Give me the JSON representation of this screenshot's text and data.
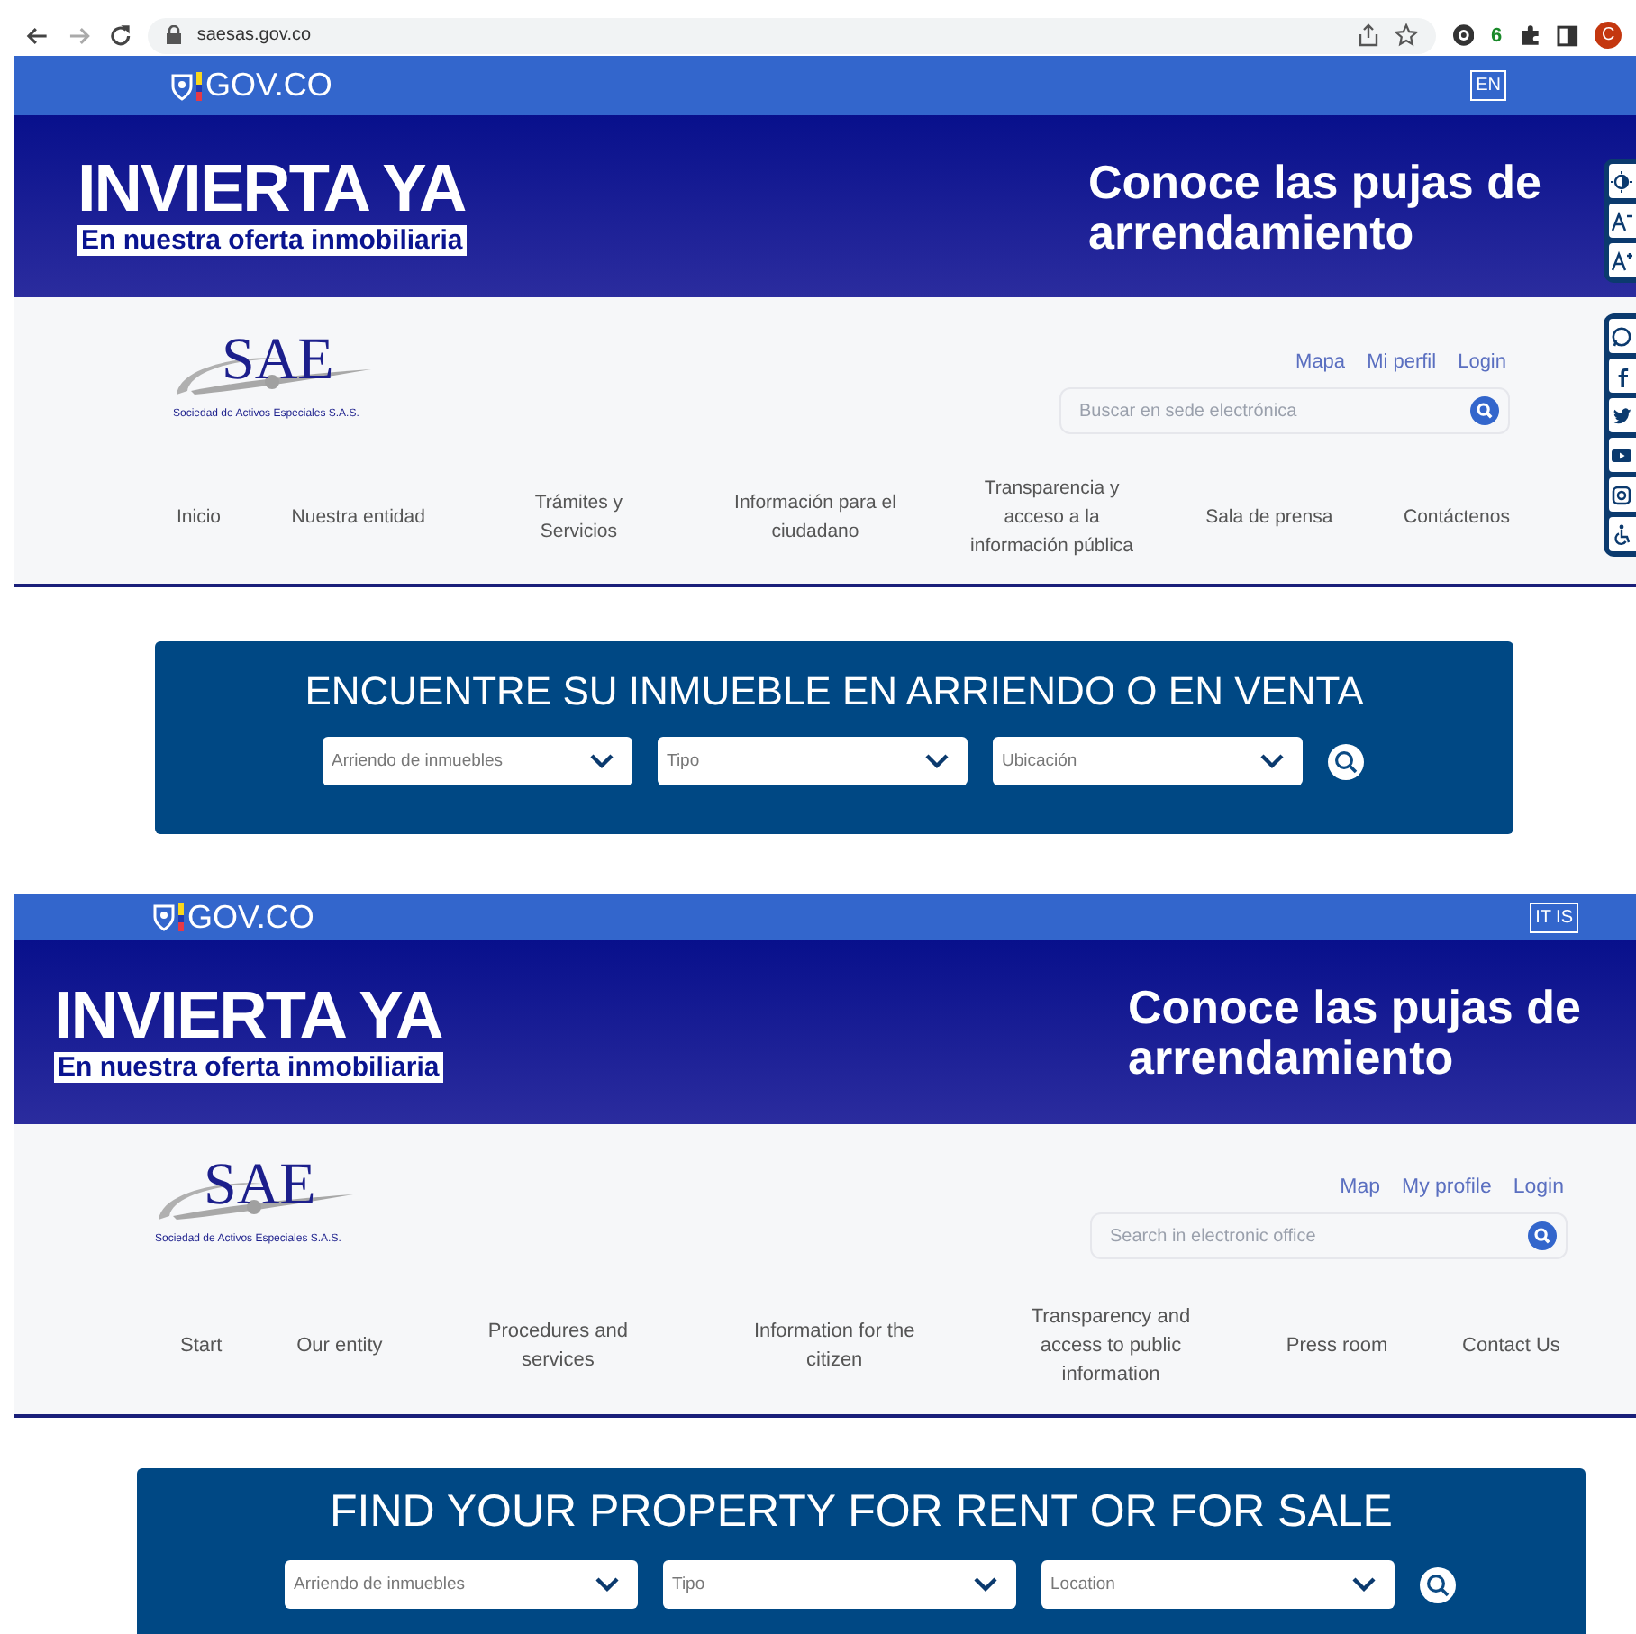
{
  "browser": {
    "url": "saesas.gov.co",
    "extension_badge": "6",
    "profile_initial": "C"
  },
  "pages": [
    {
      "gov_bar": {
        "logo_text": "GOV.CO",
        "language_button": "EN"
      },
      "banner": {
        "headline": "INVIERTA YA",
        "subheadline": "En nuestra oferta inmobiliaria",
        "right_text": "Conoce las pujas de arrendamiento"
      },
      "header": {
        "logo": "SAE",
        "logo_caption": "Sociedad de Activos Especiales S.A.S.",
        "top_links": [
          "Mapa",
          "Mi perfil",
          "Login"
        ],
        "search_placeholder": "Buscar en sede electrónica",
        "nav": [
          "Inicio",
          "Nuestra entidad",
          "Trámites y Servicios",
          "Información para el ciudadano",
          "Transparencia y acceso a la información pública",
          "Sala de prensa",
          "Contáctenos"
        ]
      },
      "finder": {
        "title": "ENCUENTRE SU INMUEBLE EN ARRIENDO O EN VENTA",
        "selects": [
          "Arriendo de inmuebles",
          "Tipo",
          "Ubicación"
        ]
      },
      "side_toolbar": true
    },
    {
      "gov_bar": {
        "logo_text": "GOV.CO",
        "language_button": "IT IS"
      },
      "banner": {
        "headline": "INVIERTA YA",
        "subheadline": "En nuestra oferta inmobiliaria",
        "right_text": "Conoce las pujas de arrendamiento"
      },
      "header": {
        "logo": "SAE",
        "logo_caption": "Sociedad de Activos Especiales S.A.S.",
        "top_links": [
          "Map",
          "My profile",
          "Login"
        ],
        "search_placeholder": "Search in electronic office",
        "nav": [
          "Start",
          "Our entity",
          "Procedures and services",
          "Information for the citizen",
          "Transparency and access to public information",
          "Press room",
          "Contact Us"
        ]
      },
      "finder": {
        "title": "FIND YOUR PROPERTY FOR RENT OR FOR SALE",
        "selects": [
          "Arriendo de inmuebles",
          "Tipo",
          "Location"
        ]
      },
      "side_toolbar": false
    }
  ]
}
